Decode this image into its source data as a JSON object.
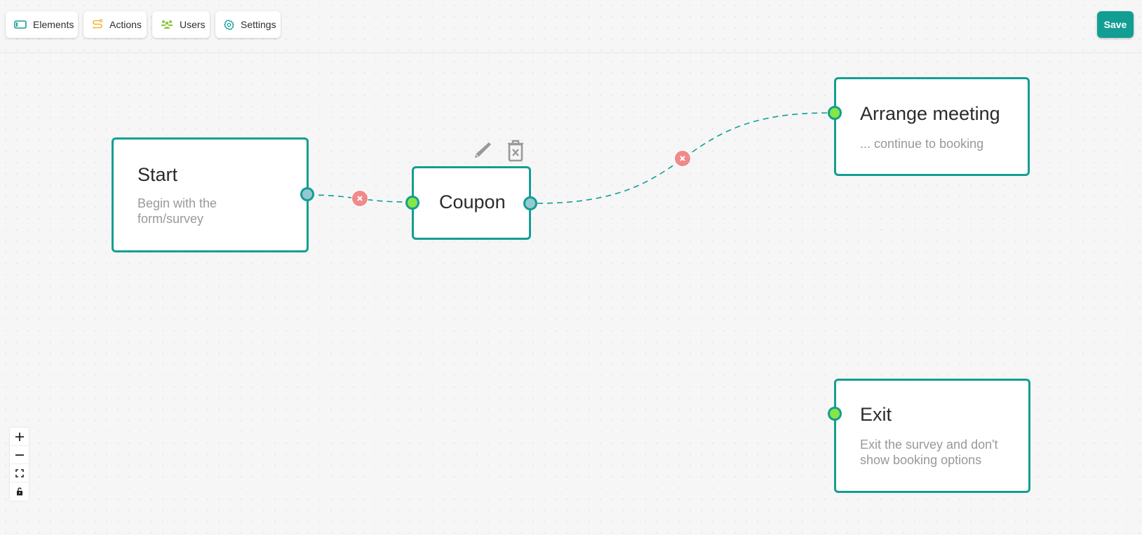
{
  "toolbar": {
    "buttons": [
      {
        "label": "Elements",
        "icon": "rectangle-icon",
        "color": "#139e93"
      },
      {
        "label": "Actions",
        "icon": "route-icon",
        "color": "#f2b233"
      },
      {
        "label": "Users",
        "icon": "users-icon",
        "color": "#8cc63f"
      },
      {
        "label": "Settings",
        "icon": "gear-icon",
        "color": "#139e93"
      }
    ],
    "save_label": "Save",
    "save_color": "#139e93"
  },
  "nodes": [
    {
      "id": "start",
      "title": "Start",
      "description": "Begin with the form/survey"
    },
    {
      "id": "coupon",
      "title": "Coupon",
      "description": ""
    },
    {
      "id": "arrange",
      "title": "Arrange meeting",
      "description": "... continue to booking"
    },
    {
      "id": "exit",
      "title": "Exit",
      "description": "Exit the survey and don't show booking options"
    }
  ],
  "edges": [
    {
      "from": "start",
      "to": "coupon",
      "style": "dashed"
    },
    {
      "from": "coupon",
      "to": "arrange",
      "style": "dashed"
    }
  ],
  "selected_node_tools": [
    "edit-icon",
    "delete-icon"
  ],
  "controls": [
    "zoom-in",
    "zoom-out",
    "fit-view",
    "lock-toggle"
  ],
  "colors": {
    "accent": "#139e93",
    "target_handle": "#86e643",
    "source_handle": "#95c9d2",
    "edge_delete": "#f08a8a"
  }
}
